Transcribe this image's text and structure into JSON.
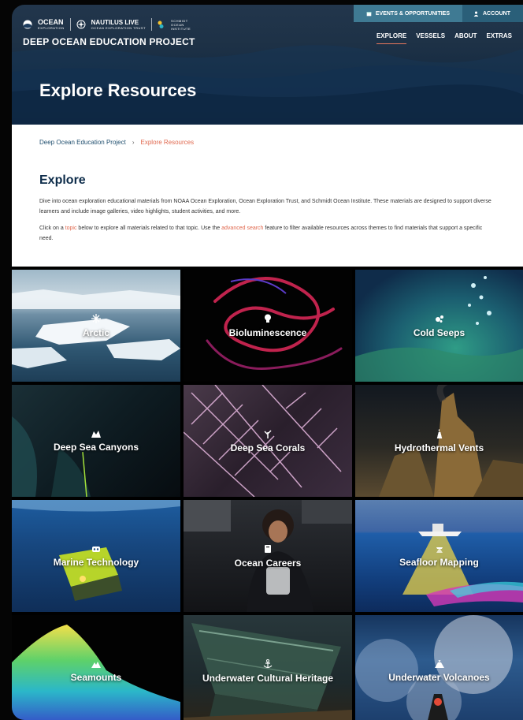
{
  "header": {
    "logos": {
      "noaa_main": "OCEAN",
      "noaa_sub": "EXPLORATION",
      "nautilus_main": "NAUTILUS LIVE",
      "nautilus_sub": "OCEAN EXPLORATION TRUST",
      "schmidt_main": "SCHMIDT",
      "schmidt_sub1": "OCEAN",
      "schmidt_sub2": "INSTITUTE"
    },
    "project_title": "DEEP OCEAN EDUCATION PROJECT",
    "top_buttons": {
      "events": "EVENTS & OPPORTUNITIES",
      "account": "ACCOUNT"
    },
    "nav": [
      "EXPLORE",
      "VESSELS",
      "ABOUT",
      "EXTRAS"
    ],
    "hero_title": "Explore Resources"
  },
  "breadcrumb": {
    "home": "Deep Ocean Education Project",
    "separator": "›",
    "current": "Explore Resources"
  },
  "intro": {
    "heading": "Explore",
    "p1": "Dive into ocean exploration educational materials from NOAA Ocean Exploration, Ocean Exploration Trust, and Schmidt Ocean Institute. These materials are designed to support diverse learners and include image galleries, video highlights, student activities, and more.",
    "p2_a": "Click on a ",
    "p2_link1": "topic",
    "p2_b": " below to explore all materials related to that topic. Use the ",
    "p2_link2": "advanced search",
    "p2_c": " feature to filter available resources across themes to find materials that support a specific need."
  },
  "topics": [
    {
      "label": "Arctic",
      "icon": "snowflake-icon"
    },
    {
      "label": "Bioluminescence",
      "icon": "lightbulb-icon"
    },
    {
      "label": "Cold Seeps",
      "icon": "bubbles-icon"
    },
    {
      "label": "Deep Sea Canyons",
      "icon": "canyon-icon"
    },
    {
      "label": "Deep Sea Corals",
      "icon": "coral-icon"
    },
    {
      "label": "Hydrothermal Vents",
      "icon": "vent-icon"
    },
    {
      "label": "Marine Technology",
      "icon": "robot-icon"
    },
    {
      "label": "Ocean Careers",
      "icon": "badge-icon"
    },
    {
      "label": "Seafloor Mapping",
      "icon": "sonar-icon"
    },
    {
      "label": "Seamounts",
      "icon": "mountain-icon"
    },
    {
      "label": "Underwater Cultural Heritage",
      "icon": "anchor-icon"
    },
    {
      "label": "Underwater Volcanoes",
      "icon": "volcano-icon"
    }
  ],
  "colors": {
    "accent": "#e0684e",
    "navy": "#0d2c4a",
    "teal_button": "#3f7a93"
  }
}
